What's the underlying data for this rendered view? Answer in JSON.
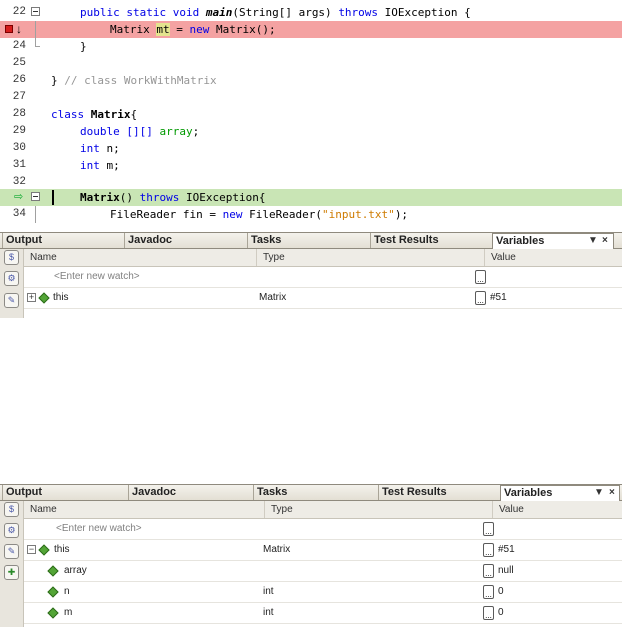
{
  "editor": {
    "lines": [
      {
        "n": "22"
      },
      {
        "n": ""
      },
      {
        "n": "24"
      },
      {
        "n": "25"
      },
      {
        "n": "26"
      },
      {
        "n": "27"
      },
      {
        "n": "28"
      },
      {
        "n": "29"
      },
      {
        "n": "30"
      },
      {
        "n": "31"
      },
      {
        "n": "32"
      },
      {
        "n": ""
      },
      {
        "n": "34"
      }
    ],
    "code": {
      "l22_a": "public static void ",
      "l22_main": "main",
      "l22_b": "(String[] args) ",
      "l22_throws": "throws",
      "l22_c": " IOException {",
      "l23_a": "Matrix ",
      "l23_mt": "mt",
      "l23_b": " = ",
      "l23_new": "new",
      "l23_c": " Matrix();",
      "l24": "}",
      "l26_a": "} ",
      "l26_cm": "// class WorkWithMatrix",
      "l28_kw": "class",
      "l28_sp": " ",
      "l28_name": "Matrix",
      "l28_b": "{",
      "l29_a": "double [][] ",
      "l29_b": "array",
      "l29_c": ";",
      "l30_kw": "int",
      "l30_b": " n;",
      "l31_kw": "int",
      "l31_b": " m;",
      "l33_name": "Matrix",
      "l33_a": "() ",
      "l33_throws": "throws",
      "l33_b": " IOException{",
      "l34_a": "FileReader fin = ",
      "l34_new": "new",
      "l34_b": " FileReader(",
      "l34_str": "\"input.txt\"",
      "l34_c": ");"
    },
    "colors": {
      "breakpoint_line": "#f4a2a2",
      "current_line": "#c9e5b5",
      "keyword": "#0000e6",
      "comment": "#969696",
      "string": "#ce7b00"
    }
  },
  "panel1": {
    "tabs": [
      "Output",
      "Javadoc",
      "Tasks",
      "Test Results",
      "Variables"
    ],
    "controls": {
      "menu": "▼",
      "close": "×"
    },
    "columns": [
      "Name",
      "Type",
      "Value"
    ],
    "rows": [
      {
        "name": "<Enter new watch>",
        "type": "",
        "value": ""
      },
      {
        "name": "this",
        "type": "Matrix",
        "value": "#51"
      }
    ]
  },
  "panel2": {
    "tabs": [
      "Output",
      "Javadoc",
      "Tasks",
      "Test Results",
      "Variables"
    ],
    "controls": {
      "menu": "▼",
      "close": "×"
    },
    "columns": [
      "Name",
      "Type",
      "Value"
    ],
    "rows": [
      {
        "name": "<Enter new watch>",
        "type": "",
        "value": ""
      },
      {
        "name": "this",
        "type": "Matrix",
        "value": "#51"
      },
      {
        "name": "array",
        "type": "",
        "value": "null"
      },
      {
        "name": "n",
        "type": "int",
        "value": "0"
      },
      {
        "name": "m",
        "type": "int",
        "value": "0"
      }
    ]
  }
}
